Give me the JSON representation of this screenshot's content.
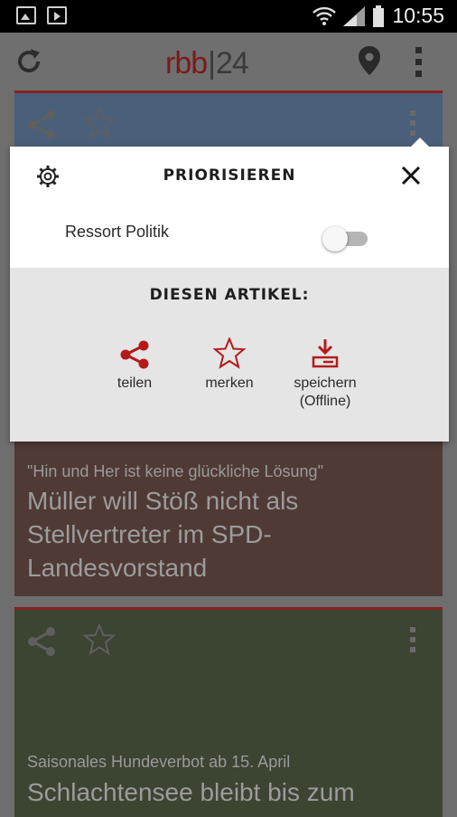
{
  "statusbar": {
    "time": "10:55"
  },
  "appbar": {
    "logo_left": "rbb",
    "logo_sep": "|",
    "logo_right": "24"
  },
  "cards": [
    {
      "kicker": "\"Hin und Her ist keine glückliche Lösung\"",
      "headline": "Müller will Stöß nicht als Stellvertreter im SPD-Landesvorstand"
    },
    {
      "kicker": "Saisonales Hundeverbot ab 15. April",
      "headline": "Schlachtensee bleibt bis zum"
    }
  ],
  "popup": {
    "title": "PRIORISIEREN",
    "toggle_label": "Ressort Politik",
    "toggle_on": false,
    "section_title": "DIESEN ARTIKEL:",
    "actions": [
      {
        "label": "teilen",
        "icon": "share-icon"
      },
      {
        "label": "merken",
        "icon": "star-icon"
      },
      {
        "label": "speichern\n(Offline)",
        "icon": "download-icon"
      }
    ]
  },
  "colors": {
    "accent": "#b51a1a",
    "scrim": "#6e6e6e",
    "popup_lower": "#e5e5e5"
  }
}
